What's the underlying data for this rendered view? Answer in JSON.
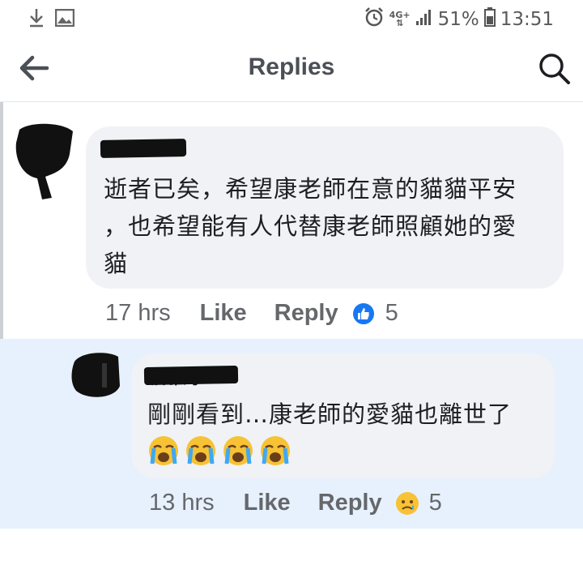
{
  "status_bar": {
    "network": "4G+",
    "battery": "51%",
    "time": "13:51"
  },
  "header": {
    "title": "Replies"
  },
  "comments": [
    {
      "author": "",
      "text_lines": [
        "逝者已矣，希望康老師在意的貓貓平安",
        "，也希望能有人代替康老師照顧她的愛",
        "貓"
      ],
      "time": "17 hrs",
      "like_label": "Like",
      "reply_label": "Reply",
      "reaction_icon": "like-icon",
      "reaction_count": "5"
    },
    {
      "author": "詹雅鈞",
      "text_lines": [
        "剛剛看到…康老師的愛貓也離世了"
      ],
      "emoji_count": 4,
      "emoji_name": "loudly-crying-face",
      "time": "13 hrs",
      "like_label": "Like",
      "reply_label": "Reply",
      "reaction_icon": "sad-icon",
      "reaction_count": "5"
    }
  ],
  "colors": {
    "accent": "#1877f2",
    "reply_highlight": "#e7f1fd",
    "bubble": "#f0f2f5"
  }
}
